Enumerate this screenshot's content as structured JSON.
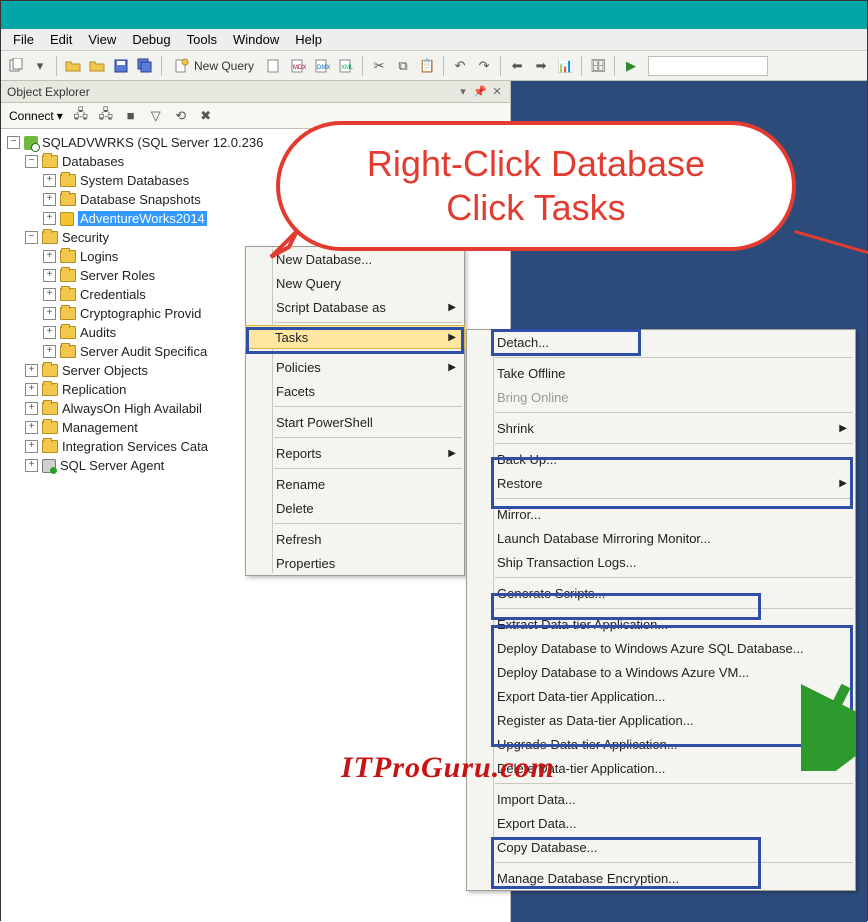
{
  "menubar": [
    "File",
    "Edit",
    "View",
    "Debug",
    "Tools",
    "Window",
    "Help"
  ],
  "toolbar": {
    "newQuery": "New Query"
  },
  "explorer": {
    "title": "Object Explorer",
    "connect": "Connect",
    "server": "SQLADVWRKS (SQL Server 12.0.236",
    "nodes": {
      "databases": "Databases",
      "sysdb": "System Databases",
      "snapshots": "Database Snapshots",
      "aw": "AdventureWorks2014",
      "security": "Security",
      "logins": "Logins",
      "serverRoles": "Server Roles",
      "credentials": "Credentials",
      "crypto": "Cryptographic Provid",
      "audits": "Audits",
      "auditSpec": "Server Audit Specifica",
      "serverObjects": "Server Objects",
      "replication": "Replication",
      "alwaysOn": "AlwaysOn High Availabil",
      "management": "Management",
      "ssis": "Integration Services Cata",
      "agent": "SQL Server Agent"
    }
  },
  "ctx1": {
    "newDb": "New Database...",
    "newQuery": "New Query",
    "scriptDb": "Script Database as",
    "tasks": "Tasks",
    "policies": "Policies",
    "facets": "Facets",
    "startPs": "Start PowerShell",
    "reports": "Reports",
    "rename": "Rename",
    "delete": "Delete",
    "refresh": "Refresh",
    "properties": "Properties"
  },
  "ctx2": {
    "detach": "Detach...",
    "takeOffline": "Take Offline",
    "bringOnline": "Bring Online",
    "shrink": "Shrink",
    "backUp": "Back Up...",
    "restore": "Restore",
    "mirror": "Mirror...",
    "launchMirror": "Launch Database Mirroring Monitor...",
    "shipLogs": "Ship Transaction Logs...",
    "genScripts": "Generate Scripts...",
    "extract": "Extract Data-tier Application...",
    "deployAzureDb": "Deploy Database to Windows Azure SQL Database...",
    "deployAzureVm": "Deploy Database to a Windows Azure VM...",
    "exportDac": "Export Data-tier Application...",
    "registerDac": "Register as Data-tier Application...",
    "upgradeDac": "Upgrade Data-tier Application...",
    "deleteDac": "Delete Data-tier Application...",
    "importData": "Import Data...",
    "exportData": "Export Data...",
    "copyDb": "Copy Database...",
    "manageEnc": "Manage Database Encryption..."
  },
  "callout": {
    "line1": "Right-Click Database",
    "line2": "Click Tasks"
  },
  "watermark": "ITProGuru.com"
}
